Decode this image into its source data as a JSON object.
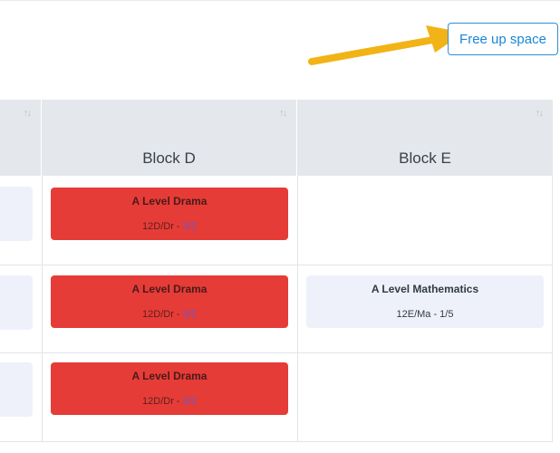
{
  "toolbar": {
    "free_up_space_label": "Free up space"
  },
  "table": {
    "columns": [
      {
        "title": ""
      },
      {
        "title": "Block D"
      },
      {
        "title": "Block E"
      }
    ],
    "sort_glyph": "↑↓",
    "rows": [
      {
        "block_d": {
          "name": "A Level Drama",
          "code": "12D/Dr - ",
          "fraction": "3/2",
          "color": "#e63c37"
        },
        "block_e": null
      },
      {
        "block_d": {
          "name": "A Level Drama",
          "code": "12D/Dr - ",
          "fraction": "3/2",
          "color": "#e63c37"
        },
        "block_e": {
          "name": "A Level Mathematics",
          "code": "12E/Ma - 1/5",
          "color": "#eef1fa"
        }
      },
      {
        "block_d": {
          "name": "A Level Drama",
          "code": "12D/Dr - ",
          "fraction": "3/2",
          "color": "#e63c37"
        },
        "block_e": null
      }
    ]
  },
  "annotation": {
    "arrow_color": "#f2b316"
  }
}
